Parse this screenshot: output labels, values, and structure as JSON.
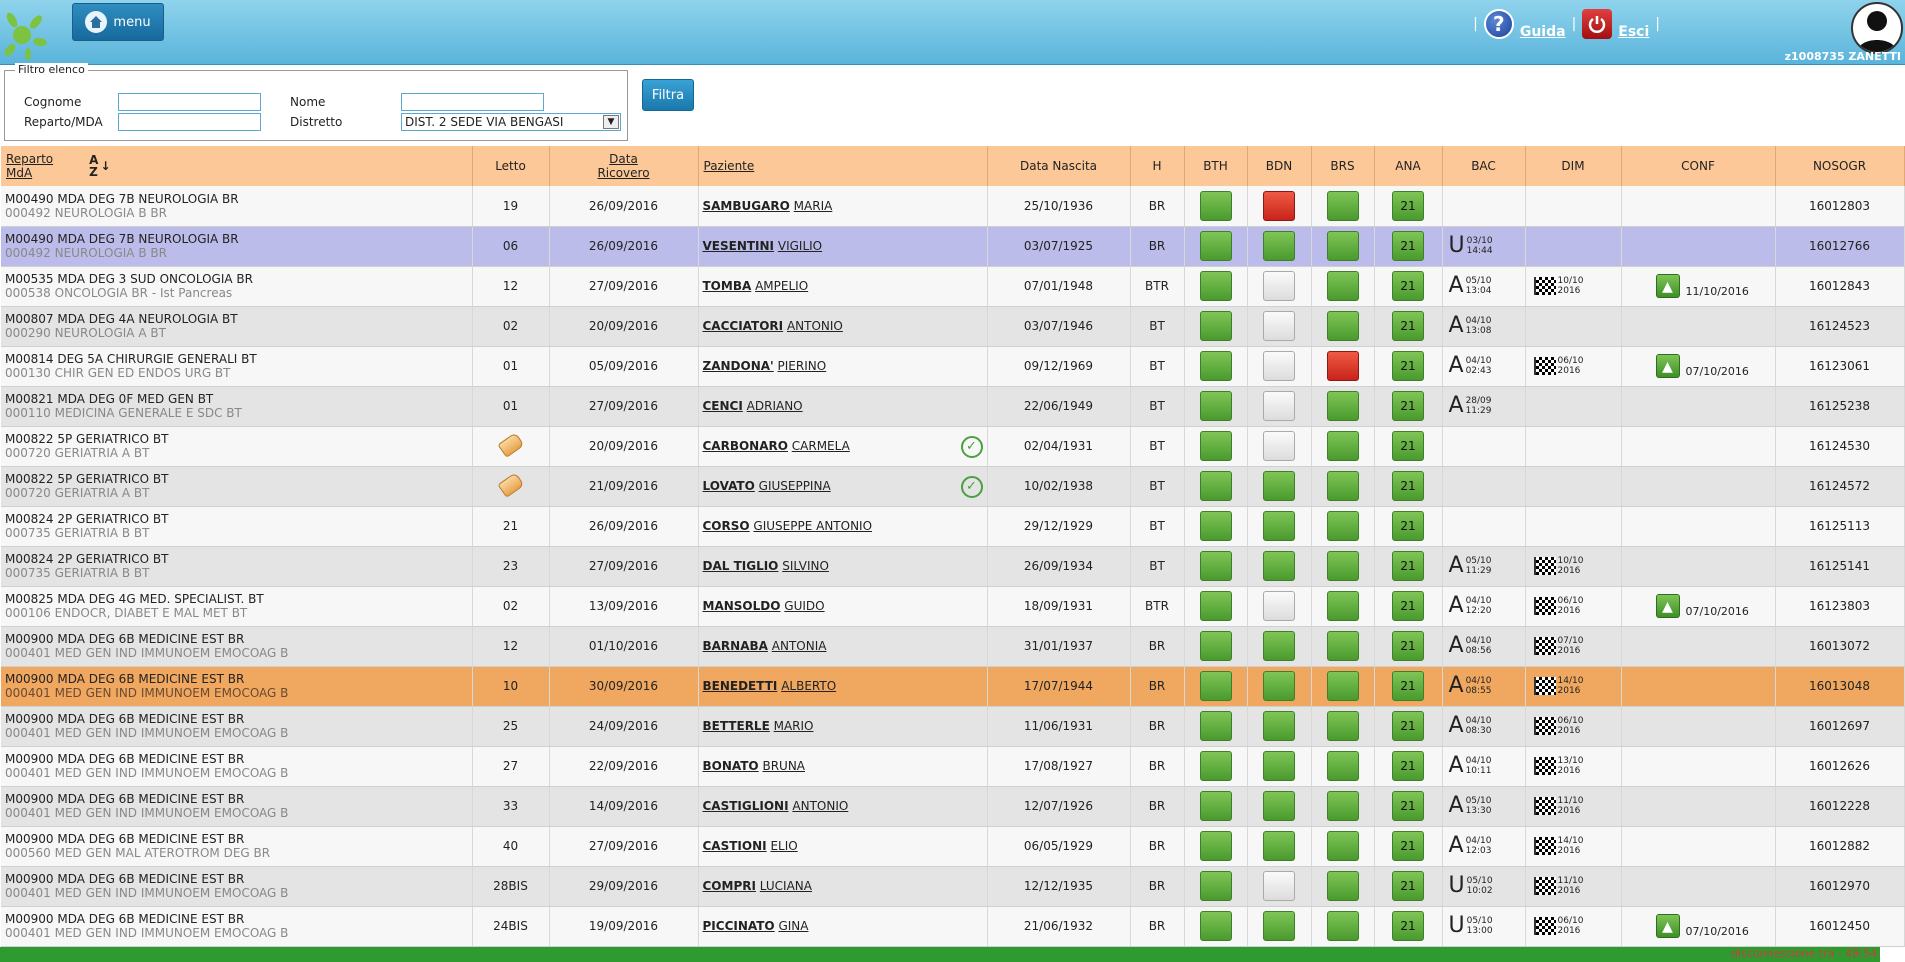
{
  "header": {
    "menu_label": "menu",
    "guida_label": "Guida",
    "esci_label": "Esci",
    "sep": "|",
    "user": "z1008735  ZANETTI"
  },
  "filter": {
    "legend": "Filtro elenco",
    "cognome_label": "Cognome",
    "nome_label": "Nome",
    "reparto_label": "Reparto/MDA",
    "distretto_label": "Distretto",
    "cognome_value": "",
    "nome_value": "",
    "reparto_value": "",
    "distretto_value": "DIST. 2 SEDE VIA BENGASI",
    "button": "Filtra"
  },
  "columns": {
    "reparto": "Reparto",
    "mda": "MdA",
    "sort": "A Z",
    "letto": "Letto",
    "data": "Data",
    "ricovero": "Ricovero",
    "paziente": "Paziente",
    "nascita": "Data Nascita",
    "h": "H",
    "bth": "BTH",
    "bdn": "BDN",
    "brs": "BRS",
    "ana": "ANA",
    "bac": "BAC",
    "dim": "DIM",
    "conf": "CONF",
    "nosogr": "NOSOGR"
  },
  "rows": [
    {
      "r1": "M00490 MDA DEG 7B NEUROLOGIA BR",
      "r2": "000492 NEUROLOGIA B BR",
      "letto": "19",
      "ric": "26/09/2016",
      "cog": "SAMBUGARO",
      "nom": "MARIA",
      "nasc": "25/10/1936",
      "h": "BR",
      "bth": "g",
      "bdn": "r",
      "brs": "g",
      "ana": "21",
      "bac_l": "",
      "bac_d": "",
      "bac_t": "",
      "dim_d": "",
      "dim_y": "",
      "conf": "",
      "noso": "16012803",
      "style": "odd",
      "chk": false,
      "tag": false
    },
    {
      "r1": "M00490 MDA DEG 7B NEUROLOGIA BR",
      "r2": "000492 NEUROLOGIA B BR",
      "letto": "06",
      "ric": "26/09/2016",
      "cog": "VESENTINI",
      "nom": "VIGILIO",
      "nasc": "03/07/1925",
      "h": "BR",
      "bth": "g",
      "bdn": "g",
      "brs": "g",
      "ana": "21",
      "bac_l": "U",
      "bac_d": "03/10",
      "bac_t": "14:44",
      "dim_d": "",
      "dim_y": "",
      "conf": "",
      "noso": "16012766",
      "style": "sel",
      "chk": false,
      "tag": false
    },
    {
      "r1": "M00535 MDA DEG 3 SUD ONCOLOGIA BR",
      "r2": "000538 ONCOLOGIA BR - Ist Pancreas",
      "letto": "12",
      "ric": "27/09/2016",
      "cog": "TOMBA",
      "nom": "AMPELIO",
      "nasc": "07/01/1948",
      "h": "BTR",
      "bth": "g",
      "bdn": "w",
      "brs": "g",
      "ana": "21",
      "bac_l": "A",
      "bac_d": "05/10",
      "bac_t": "13:04",
      "dim_d": "10/10",
      "dim_y": "2016",
      "conf": "11/10/2016",
      "noso": "16012843",
      "style": "odd",
      "chk": false,
      "tag": false
    },
    {
      "r1": "M00807 MDA DEG 4A NEUROLOGIA BT",
      "r2": "000290 NEUROLOGIA A BT",
      "letto": "02",
      "ric": "20/09/2016",
      "cog": "CACCIATORI",
      "nom": "ANTONIO",
      "nasc": "03/07/1946",
      "h": "BT",
      "bth": "g",
      "bdn": "w",
      "brs": "g",
      "ana": "21",
      "bac_l": "A",
      "bac_d": "04/10",
      "bac_t": "13:08",
      "dim_d": "",
      "dim_y": "",
      "conf": "",
      "noso": "16124523",
      "style": "even",
      "chk": false,
      "tag": false
    },
    {
      "r1": "M00814 DEG 5A CHIRURGIE GENERALI BT",
      "r2": "000130 CHIR GEN ED ENDOS URG BT",
      "letto": "01",
      "ric": "05/09/2016",
      "cog": "ZANDONA'",
      "nom": "PIERINO",
      "nasc": "09/12/1969",
      "h": "BT",
      "bth": "g",
      "bdn": "w",
      "brs": "r",
      "ana": "21",
      "bac_l": "A",
      "bac_d": "04/10",
      "bac_t": "02:43",
      "dim_d": "06/10",
      "dim_y": "2016",
      "conf": "07/10/2016",
      "noso": "16123061",
      "style": "odd",
      "chk": false,
      "tag": false
    },
    {
      "r1": "M00821 MDA DEG 0F MED GEN BT",
      "r2": "000110 MEDICINA GENERALE E SDC BT",
      "letto": "01",
      "ric": "27/09/2016",
      "cog": "CENCI",
      "nom": "ADRIANO",
      "nasc": "22/06/1949",
      "h": "BT",
      "bth": "g",
      "bdn": "w",
      "brs": "g",
      "ana": "21",
      "bac_l": "A",
      "bac_d": "28/09",
      "bac_t": "11:29",
      "dim_d": "",
      "dim_y": "",
      "conf": "",
      "noso": "16125238",
      "style": "even",
      "chk": false,
      "tag": false
    },
    {
      "r1": "M00822 5P GERIATRICO BT",
      "r2": "000720 GERIATRIA A BT",
      "letto": "",
      "ric": "20/09/2016",
      "cog": "CARBONARO",
      "nom": "CARMELA",
      "nasc": "02/04/1931",
      "h": "BT",
      "bth": "g",
      "bdn": "w",
      "brs": "g",
      "ana": "21",
      "bac_l": "",
      "bac_d": "",
      "bac_t": "",
      "dim_d": "",
      "dim_y": "",
      "conf": "",
      "noso": "16124530",
      "style": "odd",
      "chk": true,
      "tag": true
    },
    {
      "r1": "M00822 5P GERIATRICO BT",
      "r2": "000720 GERIATRIA A BT",
      "letto": "",
      "ric": "21/09/2016",
      "cog": "LOVATO",
      "nom": "GIUSEPPINA",
      "nasc": "10/02/1938",
      "h": "BT",
      "bth": "g",
      "bdn": "g",
      "brs": "g",
      "ana": "21",
      "bac_l": "",
      "bac_d": "",
      "bac_t": "",
      "dim_d": "",
      "dim_y": "",
      "conf": "",
      "noso": "16124572",
      "style": "even",
      "chk": true,
      "tag": true
    },
    {
      "r1": "M00824 2P GERIATRICO BT",
      "r2": "000735 GERIATRIA B BT",
      "letto": "21",
      "ric": "26/09/2016",
      "cog": "CORSO",
      "nom": "GIUSEPPE ANTONIO",
      "nasc": "29/12/1929",
      "h": "BT",
      "bth": "g",
      "bdn": "g",
      "brs": "g",
      "ana": "21",
      "bac_l": "",
      "bac_d": "",
      "bac_t": "",
      "dim_d": "",
      "dim_y": "",
      "conf": "",
      "noso": "16125113",
      "style": "odd",
      "chk": false,
      "tag": false
    },
    {
      "r1": "M00824 2P GERIATRICO BT",
      "r2": "000735 GERIATRIA B BT",
      "letto": "23",
      "ric": "27/09/2016",
      "cog": "DAL TIGLIO",
      "nom": "SILVINO",
      "nasc": "26/09/1934",
      "h": "BT",
      "bth": "g",
      "bdn": "g",
      "brs": "g",
      "ana": "21",
      "bac_l": "A",
      "bac_d": "05/10",
      "bac_t": "11:29",
      "dim_d": "10/10",
      "dim_y": "2016",
      "conf": "",
      "noso": "16125141",
      "style": "even",
      "chk": false,
      "tag": false
    },
    {
      "r1": "M00825 MDA DEG 4G MED. SPECIALIST. BT",
      "r2": "000106 ENDOCR, DIABET E MAL MET BT",
      "letto": "02",
      "ric": "13/09/2016",
      "cog": "MANSOLDO",
      "nom": "GUIDO",
      "nasc": "18/09/1931",
      "h": "BTR",
      "bth": "g",
      "bdn": "w",
      "brs": "g",
      "ana": "21",
      "bac_l": "A",
      "bac_d": "04/10",
      "bac_t": "12:20",
      "dim_d": "06/10",
      "dim_y": "2016",
      "conf": "07/10/2016",
      "noso": "16123803",
      "style": "odd",
      "chk": false,
      "tag": false
    },
    {
      "r1": "M00900 MDA DEG 6B MEDICINE EST BR",
      "r2": "000401 MED GEN IND IMMUNOEM EMOCOAG B",
      "letto": "12",
      "ric": "01/10/2016",
      "cog": "BARNABA",
      "nom": "ANTONIA",
      "nasc": "31/01/1937",
      "h": "BR",
      "bth": "g",
      "bdn": "g",
      "brs": "g",
      "ana": "21",
      "bac_l": "A",
      "bac_d": "04/10",
      "bac_t": "08:56",
      "dim_d": "07/10",
      "dim_y": "2016",
      "conf": "",
      "noso": "16013072",
      "style": "even",
      "chk": false,
      "tag": false
    },
    {
      "r1": "M00900 MDA DEG 6B MEDICINE EST BR",
      "r2": "000401 MED GEN IND IMMUNOEM EMOCOAG B",
      "letto": "10",
      "ric": "30/09/2016",
      "cog": "BENEDETTI",
      "nom": "ALBERTO",
      "nasc": "17/07/1944",
      "h": "BR",
      "bth": "g",
      "bdn": "g",
      "brs": "g",
      "ana": "21",
      "bac_l": "A",
      "bac_d": "04/10",
      "bac_t": "08:55",
      "dim_d": "14/10",
      "dim_y": "2016",
      "conf": "",
      "noso": "16013048",
      "style": "hi",
      "chk": false,
      "tag": false
    },
    {
      "r1": "M00900 MDA DEG 6B MEDICINE EST BR",
      "r2": "000401 MED GEN IND IMMUNOEM EMOCOAG B",
      "letto": "25",
      "ric": "24/09/2016",
      "cog": "BETTERLE",
      "nom": "MARIO",
      "nasc": "11/06/1931",
      "h": "BR",
      "bth": "g",
      "bdn": "g",
      "brs": "g",
      "ana": "21",
      "bac_l": "A",
      "bac_d": "04/10",
      "bac_t": "08:30",
      "dim_d": "06/10",
      "dim_y": "2016",
      "conf": "",
      "noso": "16012697",
      "style": "even",
      "chk": false,
      "tag": false
    },
    {
      "r1": "M00900 MDA DEG 6B MEDICINE EST BR",
      "r2": "000401 MED GEN IND IMMUNOEM EMOCOAG B",
      "letto": "27",
      "ric": "22/09/2016",
      "cog": "BONATO",
      "nom": "BRUNA",
      "nasc": "17/08/1927",
      "h": "BR",
      "bth": "g",
      "bdn": "g",
      "brs": "g",
      "ana": "21",
      "bac_l": "A",
      "bac_d": "04/10",
      "bac_t": "10:11",
      "dim_d": "13/10",
      "dim_y": "2016",
      "conf": "",
      "noso": "16012626",
      "style": "odd",
      "chk": false,
      "tag": false
    },
    {
      "r1": "M00900 MDA DEG 6B MEDICINE EST BR",
      "r2": "000401 MED GEN IND IMMUNOEM EMOCOAG B",
      "letto": "33",
      "ric": "14/09/2016",
      "cog": "CASTIGLIONI",
      "nom": "ANTONIO",
      "nasc": "12/07/1926",
      "h": "BR",
      "bth": "g",
      "bdn": "g",
      "brs": "g",
      "ana": "21",
      "bac_l": "A",
      "bac_d": "05/10",
      "bac_t": "13:30",
      "dim_d": "11/10",
      "dim_y": "2016",
      "conf": "",
      "noso": "16012228",
      "style": "even",
      "chk": false,
      "tag": false
    },
    {
      "r1": "M00900 MDA DEG 6B MEDICINE EST BR",
      "r2": "000560 MED GEN MAL ATEROTROM DEG BR",
      "letto": "40",
      "ric": "27/09/2016",
      "cog": "CASTIONI",
      "nom": "ELIO",
      "nasc": "06/05/1929",
      "h": "BR",
      "bth": "g",
      "bdn": "g",
      "brs": "g",
      "ana": "21",
      "bac_l": "A",
      "bac_d": "04/10",
      "bac_t": "12:03",
      "dim_d": "14/10",
      "dim_y": "2016",
      "conf": "",
      "noso": "16012882",
      "style": "odd",
      "chk": false,
      "tag": false
    },
    {
      "r1": "M00900 MDA DEG 6B MEDICINE EST BR",
      "r2": "000401 MED GEN IND IMMUNOEM EMOCOAG B",
      "letto": "28BIS",
      "ric": "29/09/2016",
      "cog": "COMPRI",
      "nom": "LUCIANA",
      "nasc": "12/12/1935",
      "h": "BR",
      "bth": "g",
      "bdn": "w",
      "brs": "g",
      "ana": "21",
      "bac_l": "U",
      "bac_d": "05/10",
      "bac_t": "10:02",
      "dim_d": "11/10",
      "dim_y": "2016",
      "conf": "",
      "noso": "16012970",
      "style": "even",
      "chk": false,
      "tag": false
    },
    {
      "r1": "M00900 MDA DEG 6B MEDICINE EST BR",
      "r2": "000401 MED GEN IND IMMUNOEM EMOCOAG B",
      "letto": "24BIS",
      "ric": "19/09/2016",
      "cog": "PICCINATO",
      "nom": "GINA",
      "nasc": "21/06/1932",
      "h": "BR",
      "bth": "g",
      "bdn": "g",
      "brs": "g",
      "ana": "21",
      "bac_l": "U",
      "bac_d": "05/10",
      "bac_t": "13:00",
      "dim_d": "06/10",
      "dim_y": "2016",
      "conf": "07/10/2016",
      "noso": "16012450",
      "style": "odd",
      "chk": false,
      "tag": false
    }
  ],
  "footer": {
    "disconnect": "disconnessione tra - 49:54"
  }
}
